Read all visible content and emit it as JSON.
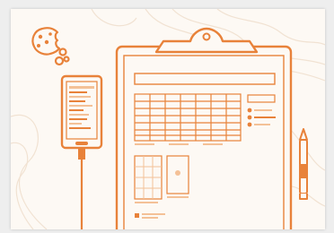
{
  "colors": {
    "accent": "#e8823a",
    "accent_light": "#f4c197",
    "paper": "#fdf9f4",
    "topo": "#f3e6d8"
  },
  "icons": [
    "cookie-icon",
    "phone-icon",
    "clipboard-icon",
    "pen-icon"
  ]
}
